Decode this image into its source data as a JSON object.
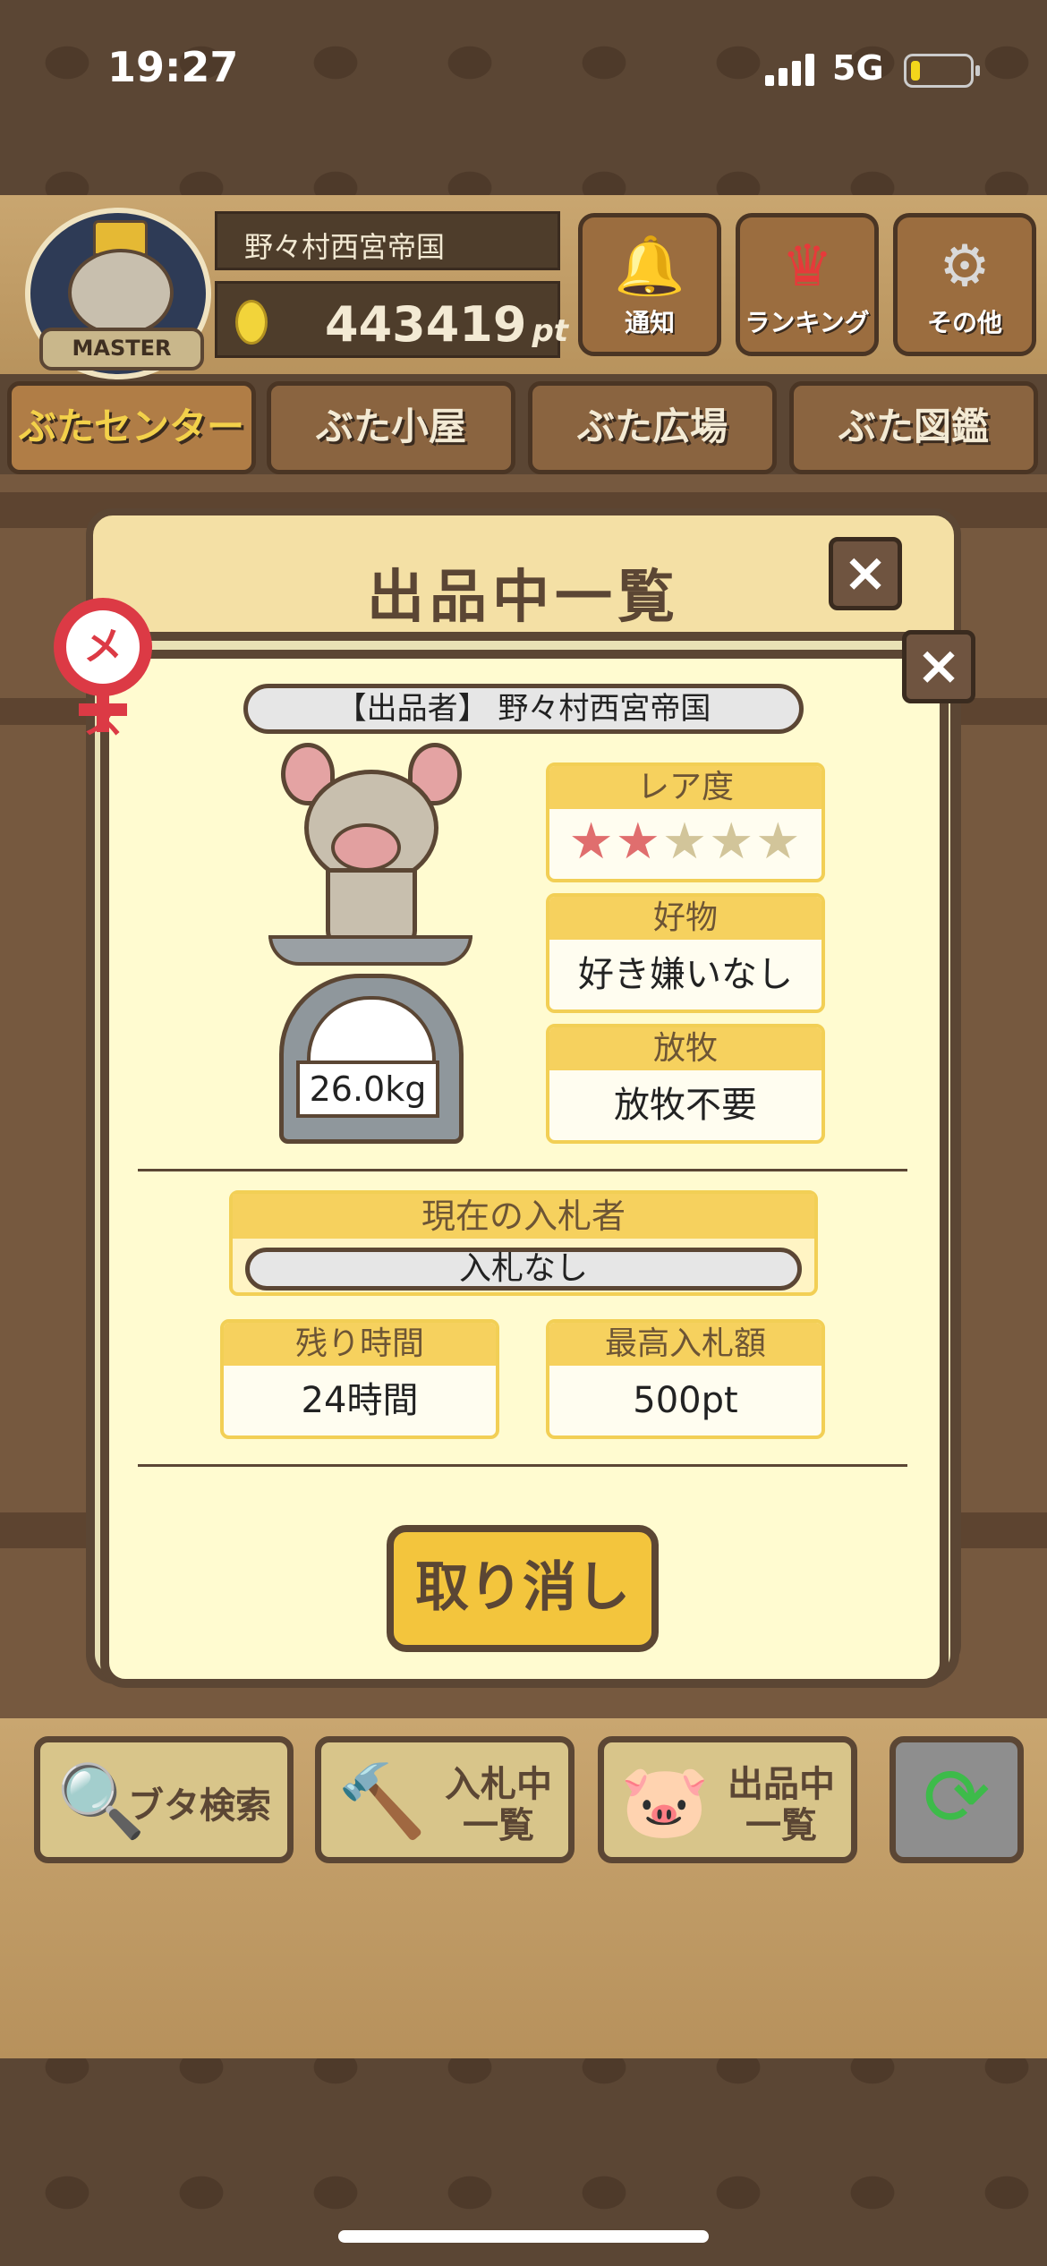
{
  "status": {
    "time": "19:27",
    "network": "5G"
  },
  "header": {
    "player_name": "野々村西宮帝国",
    "points": "443419",
    "points_unit": "pt",
    "avatar_badge": "MASTER",
    "buttons": [
      {
        "label": "通知",
        "icon": "bell-icon"
      },
      {
        "label": "ランキング",
        "icon": "crown-icon"
      },
      {
        "label": "その他",
        "icon": "gear-icon"
      }
    ]
  },
  "tabs": [
    "ぶたセンター",
    "ぶた小屋",
    "ぶた広場",
    "ぶた図鑑"
  ],
  "panel": {
    "title": "出品中一覧",
    "gender_mark": "メス",
    "seller": "【出品者】 野々村西宮帝国",
    "weight": "26.0kg",
    "rarity_label": "レア度",
    "rarity": {
      "filled": 2,
      "total": 5
    },
    "favorite_label": "好物",
    "favorite_value": "好き嫌いなし",
    "grazing_label": "放牧",
    "grazing_value": "放牧不要",
    "current_bidder_label": "現在の入札者",
    "current_bidder_value": "入札なし",
    "remaining_label": "残り時間",
    "remaining_value": "24時間",
    "max_bid_label": "最高入札額",
    "max_bid_value": "500pt",
    "cancel_label": "取り消し"
  },
  "toolbar": {
    "search_label": "ブタ検索",
    "bidding_label_1": "入札中",
    "bidding_label_2": "一覧",
    "listing_label_1": "出品中",
    "listing_label_2": "一覧",
    "refresh_icon": "refresh-icon"
  },
  "colors": {
    "accent": "#f3c53d",
    "wood_dark": "#5b4634",
    "star_on": "#e06e6e",
    "star_off": "#d2c59a"
  }
}
